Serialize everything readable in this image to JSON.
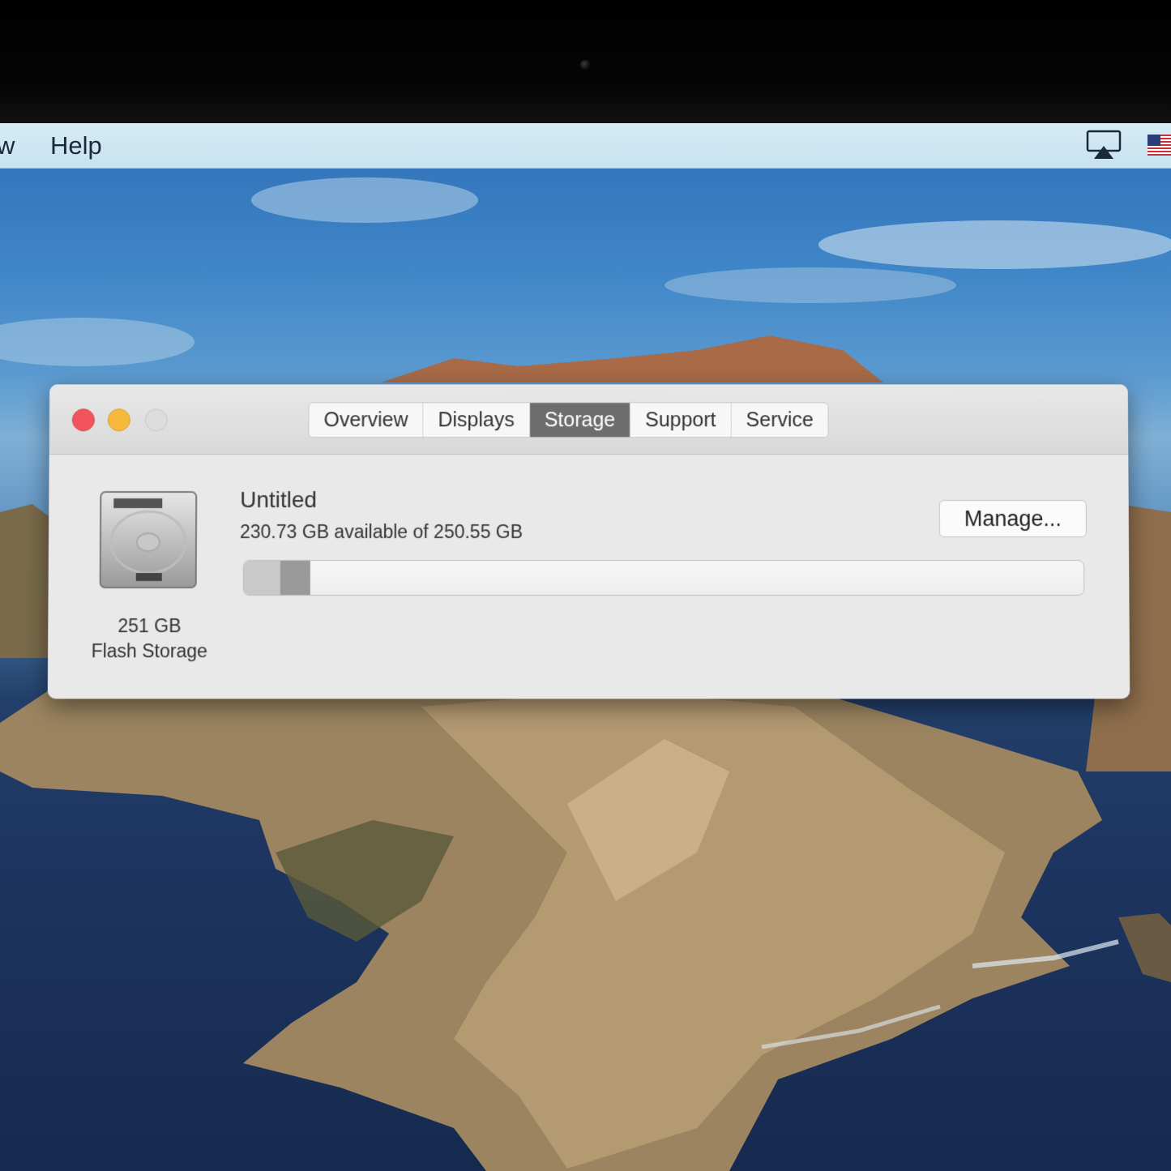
{
  "menubar": {
    "items": [
      {
        "label": "w"
      },
      {
        "label": "Help"
      }
    ],
    "status_icons": [
      "airplay-icon",
      "us-flag-icon"
    ]
  },
  "window": {
    "tabs": [
      {
        "label": "Overview",
        "active": false
      },
      {
        "label": "Displays",
        "active": false
      },
      {
        "label": "Storage",
        "active": true
      },
      {
        "label": "Support",
        "active": false
      },
      {
        "label": "Service",
        "active": false
      }
    ],
    "disk": {
      "icon": "hard-drive-icon",
      "capacity": "251 GB",
      "type": "Flash Storage"
    },
    "volume": {
      "name": "Untitled",
      "availability": "230.73 GB available of 250.55 GB",
      "manage_label": "Manage...",
      "used_fraction": 0.079,
      "segments": [
        {
          "fraction": 0.043,
          "color": "#c9c9c9"
        },
        {
          "fraction": 0.036,
          "color": "#9a9a9a"
        }
      ]
    }
  },
  "colors": {
    "close": "#f2545b",
    "minimize": "#f6b93b",
    "zoom": "#dcdcdc",
    "active_tab": "#6d6d6d"
  }
}
